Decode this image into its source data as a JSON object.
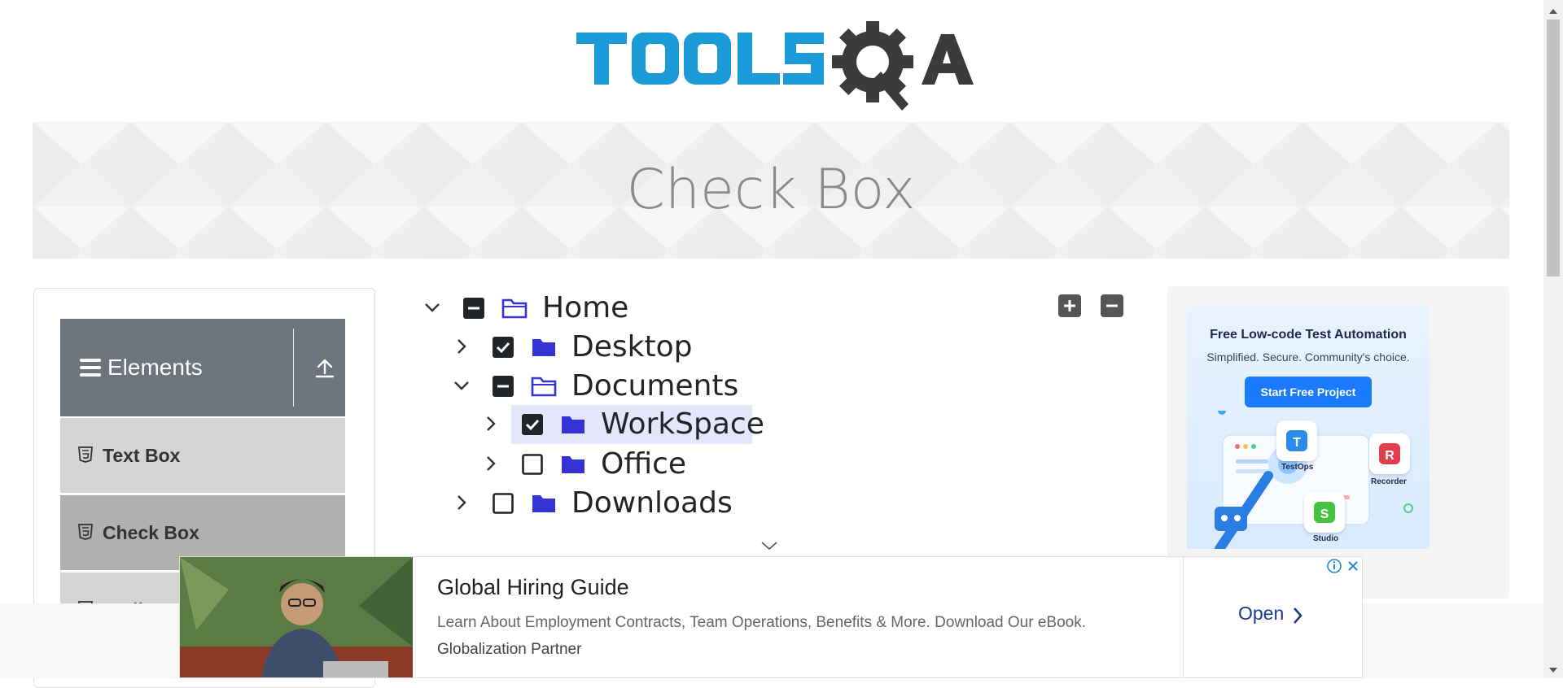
{
  "page": {
    "title": "Check Box"
  },
  "sidebar": {
    "group_title": "Elements",
    "items": [
      {
        "label": "Text Box"
      },
      {
        "label": "Check Box"
      },
      {
        "label": "Radio Button"
      }
    ]
  },
  "tree": {
    "nodes": [
      {
        "label": "Home",
        "expanded": true,
        "state": "partial"
      },
      {
        "label": "Desktop",
        "expanded": false,
        "state": "checked"
      },
      {
        "label": "Documents",
        "expanded": true,
        "state": "partial"
      },
      {
        "label": "WorkSpace",
        "expanded": false,
        "state": "checked",
        "highlighted": true
      },
      {
        "label": "Office",
        "expanded": false,
        "state": "unchecked"
      },
      {
        "label": "Downloads",
        "expanded": false,
        "state": "unchecked"
      }
    ],
    "expand_all_icon": "plus-icon",
    "collapse_all_icon": "minus-icon"
  },
  "right_ad": {
    "headline": "Free Low-code Test Automation",
    "subline": "Simplified. Secure. Community's choice.",
    "cta": "Start Free Project",
    "tiles": [
      {
        "label": "TestOps"
      },
      {
        "label": "Recorder"
      },
      {
        "label": "Studio"
      }
    ]
  },
  "bottom_ad": {
    "title": "Global Hiring Guide",
    "description": "Learn About Employment Contracts, Team Operations, Benefits & More. Download Our eBook.",
    "brand": "Globalization Partner",
    "open_label": "Open"
  },
  "colors": {
    "sidebar_header": "#6c757d",
    "folder": "#3434d6",
    "tree_highlight": "#e6e6fa",
    "logo_blue": "#1a9ad6",
    "logo_gray": "#3b3b3b"
  }
}
